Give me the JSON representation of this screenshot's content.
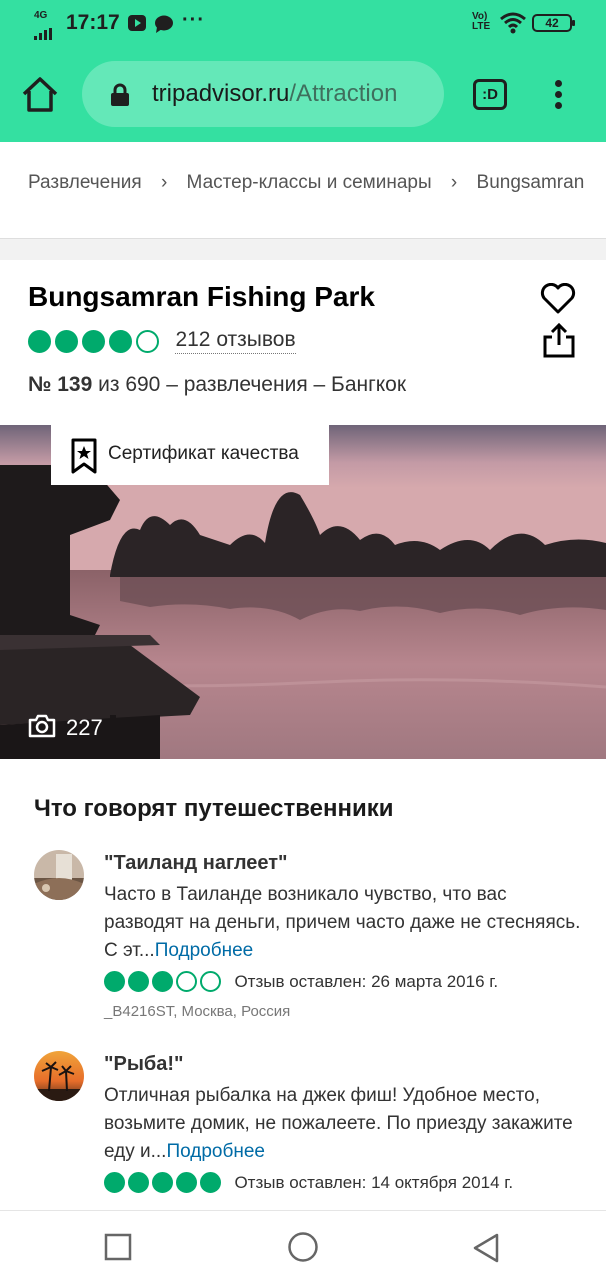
{
  "status_bar": {
    "network": "4G",
    "time": "17:17",
    "more": "···",
    "volte": "VoLTE",
    "battery": "42"
  },
  "browser": {
    "url_domain": "tripadvisor.ru",
    "url_path": "/Attraction",
    "tabs_label": ":D"
  },
  "breadcrumb": [
    "Развлечения",
    "Мастер-классы и семинары",
    "Bungsamran"
  ],
  "attraction": {
    "name": "Bungsamran Fishing Park",
    "rating": 4,
    "reviews_label": "212 отзывов",
    "rank_prefix": "№ 139",
    "rank_suffix": " из 690 – развлечения – Бангкок",
    "certificate": "Сертификат качества",
    "photo_count": "227"
  },
  "reviews_section": {
    "title": "Что говорят путешественники",
    "items": [
      {
        "title": "\"Таиланд наглеет\"",
        "text": "Часто в Таиланде возникало чувство, что вас разводят на деньги, причем часто даже не стесняясь. С эт...",
        "more": "Подробнее",
        "rating": 3,
        "date": "Отзыв оставлен: 26 марта 2016 г.",
        "author": "_B4216ST, Москва, Россия"
      },
      {
        "title": "\"Рыба!\"",
        "text": "Отличная рыбалка на джек фиш! Удобное место, возьмите домик, не пожалеете. По приезду закажите еду и...",
        "more": "Подробнее",
        "rating": 5,
        "date": "Отзыв оставлен: 14 октября 2014 г.",
        "author": ""
      }
    ]
  },
  "colors": {
    "brand": "#34e0a1",
    "bubble": "#00aa6c",
    "link": "#006ba6"
  }
}
